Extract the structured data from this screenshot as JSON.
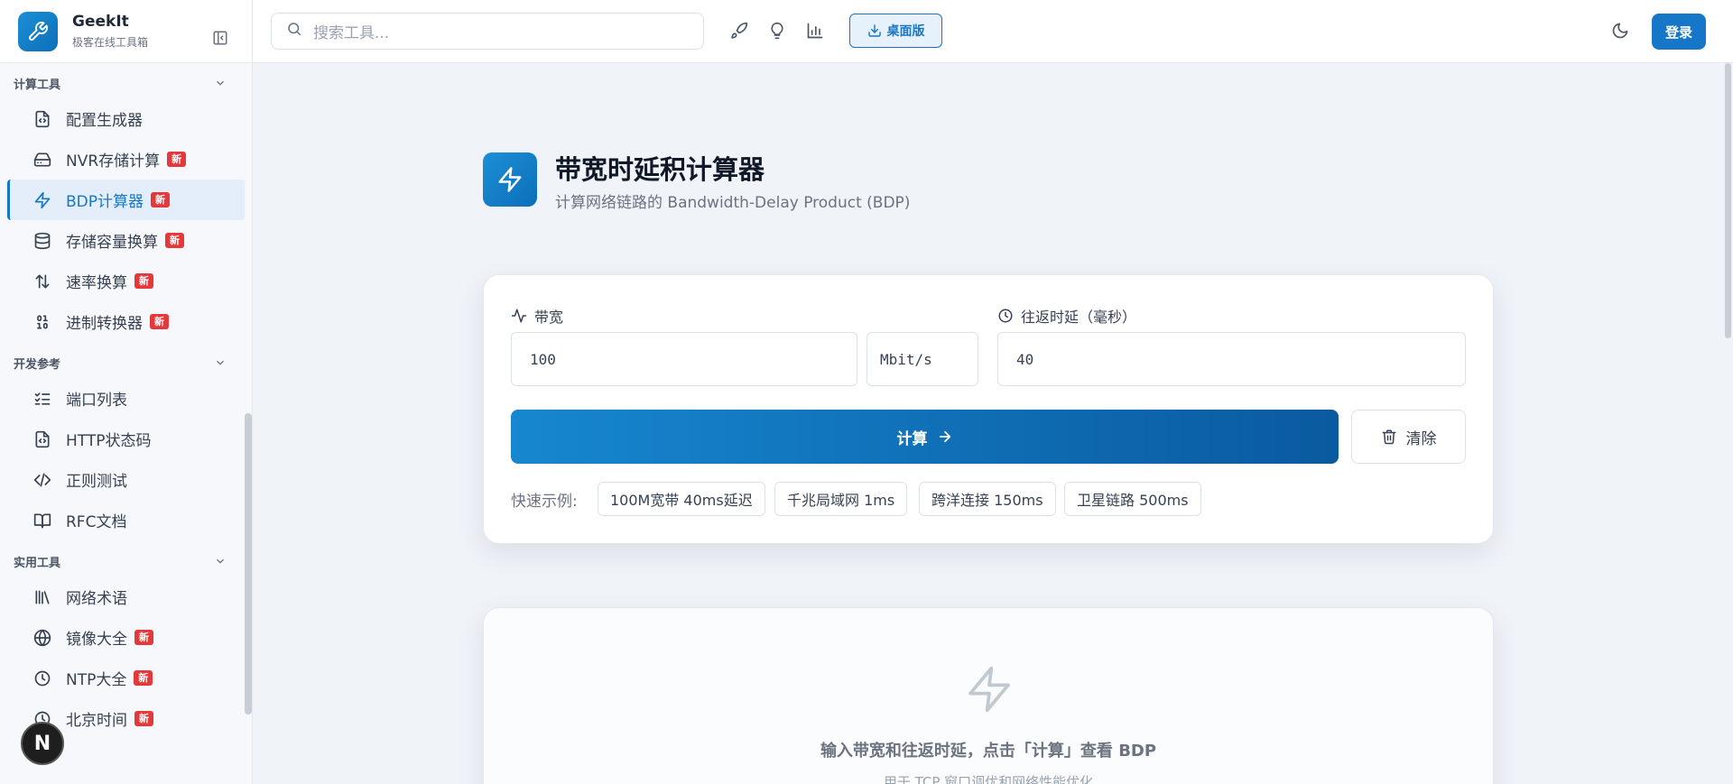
{
  "brand": {
    "name": "GeekIt",
    "subtitle": "极客在线工具箱"
  },
  "sidebar": {
    "sections": [
      {
        "title": "计算工具",
        "items": [
          {
            "label": "配置生成器",
            "icon": "file-code-icon",
            "badge": ""
          },
          {
            "label": "NVR存储计算",
            "icon": "hard-drive-icon",
            "badge": "新"
          },
          {
            "label": "BDP计算器",
            "icon": "zap-icon",
            "badge": "新",
            "active": true
          },
          {
            "label": "存储容量换算",
            "icon": "database-icon",
            "badge": "新"
          },
          {
            "label": "速率换算",
            "icon": "arrows-up-down-icon",
            "badge": "新"
          },
          {
            "label": "进制转换器",
            "icon": "binary-icon",
            "badge": "新"
          }
        ]
      },
      {
        "title": "开发参考",
        "items": [
          {
            "label": "端口列表",
            "icon": "list-checks-icon",
            "badge": ""
          },
          {
            "label": "HTTP状态码",
            "icon": "file-code-icon",
            "badge": ""
          },
          {
            "label": "正则测试",
            "icon": "code-icon",
            "badge": ""
          },
          {
            "label": "RFC文档",
            "icon": "book-icon",
            "badge": ""
          }
        ]
      },
      {
        "title": "实用工具",
        "items": [
          {
            "label": "网络术语",
            "icon": "library-icon",
            "badge": ""
          },
          {
            "label": "镜像大全",
            "icon": "globe-icon",
            "badge": "新"
          },
          {
            "label": "NTP大全",
            "icon": "clock-icon",
            "badge": "新"
          },
          {
            "label": "北京时间",
            "icon": "clock-icon",
            "badge": "新"
          }
        ]
      }
    ],
    "avatar_letter": "N"
  },
  "topbar": {
    "search_placeholder": "搜索工具...",
    "desktop_label": "桌面版",
    "login_label": "登录"
  },
  "page": {
    "title": "带宽时延积计算器",
    "subtitle": "计算网络链路的 Bandwidth-Delay Product (BDP)"
  },
  "form": {
    "bandwidth_label": "带宽",
    "bandwidth_value": "100",
    "unit_value": "Mbit/s",
    "rtt_label": "往返时延（毫秒）",
    "rtt_value": "40",
    "calc_label": "计算",
    "clear_label": "清除",
    "quick_label": "快速示例:",
    "examples": [
      "100M宽带 40ms延迟",
      "千兆局域网 1ms",
      "跨洋连接 150ms",
      "卫星链路 500ms"
    ]
  },
  "result": {
    "empty_title": "输入带宽和往返时延，点击「计算」查看 BDP",
    "empty_sub": "用于 TCP 窗口调优和网络性能优化"
  },
  "colors": {
    "accent": "#1677c8",
    "badge": "#e5383b"
  }
}
